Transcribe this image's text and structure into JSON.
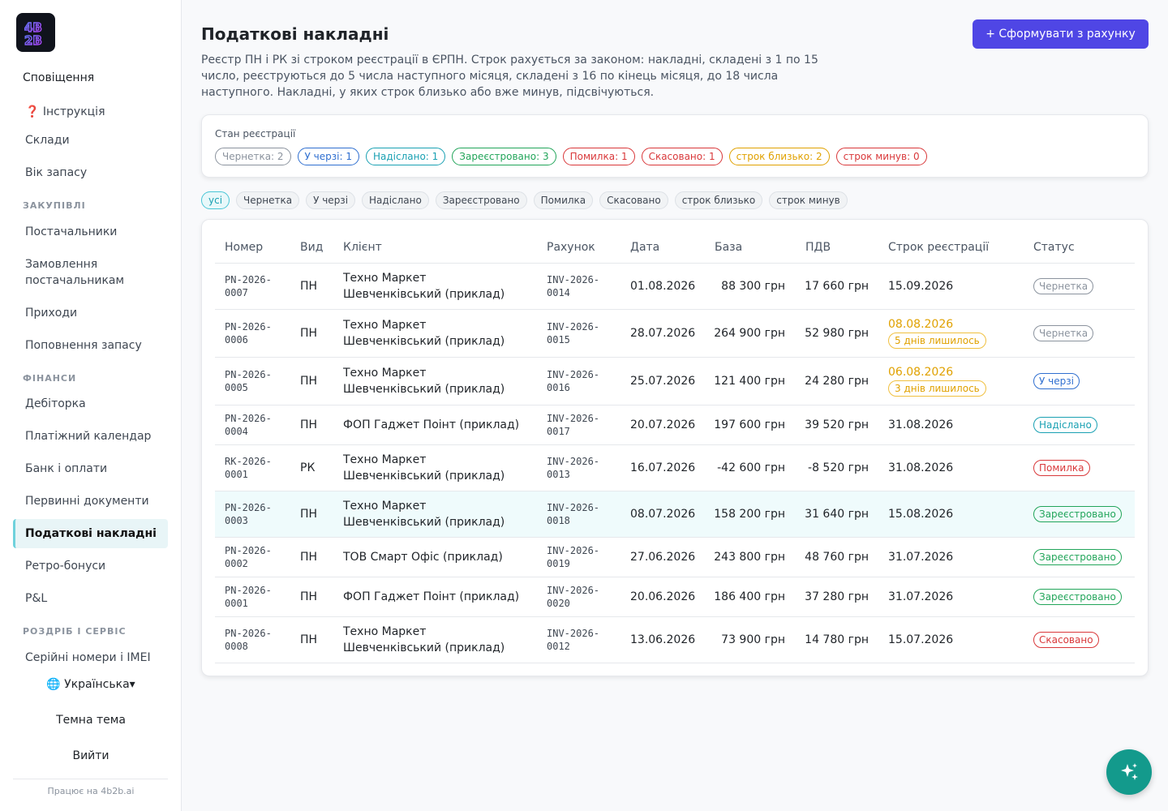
{
  "sidebar": {
    "notifications": "Сповіщення",
    "items_top": [
      {
        "label": "❓ Інструкція"
      },
      {
        "label": "Склади"
      },
      {
        "label": "Вік запасу"
      }
    ],
    "section_purchases": "ЗАКУПІВЛІ",
    "items_purchases": [
      {
        "label": "Постачальники"
      },
      {
        "label": "Замовлення постачальникам"
      },
      {
        "label": "Приходи"
      },
      {
        "label": "Поповнення запасу"
      }
    ],
    "section_finance": "ФІНАНСИ",
    "items_finance": [
      {
        "label": "Дебіторка"
      },
      {
        "label": "Платіжний календар"
      },
      {
        "label": "Банк і оплати"
      },
      {
        "label": "Первинні документи"
      },
      {
        "label": "Податкові накладні"
      },
      {
        "label": "Ретро-бонуси"
      },
      {
        "label": "P&L"
      }
    ],
    "section_retail": "РОЗДРІБ І СЕРВІС",
    "items_retail": [
      {
        "label": "Серійні номери і IMEI"
      }
    ],
    "language": "🌐 Українська▾",
    "theme": "Темна тема",
    "logout": "Вийти",
    "powered": "Працює на 4b2b.ai"
  },
  "header": {
    "title": "Податкові накладні",
    "description": "Реєстр ПН і РК зі строком реєстрації в ЄРПН. Строк рахується за законом: накладні, складені з 1 по 15 число, реєструються до 5 числа наступного місяця, складені з 16 по кінець місяця, до 18 числа наступного. Накладні, у яких строк близько або вже минув, підсвічуються.",
    "create_button": "+ Сформувати з рахунку"
  },
  "status_summary": {
    "label": "Стан реєстрації",
    "chips": [
      {
        "text": "Чернетка: 2",
        "color": "#8b939e"
      },
      {
        "text": "У черзі: 1",
        "color": "#2f6fd0"
      },
      {
        "text": "Надіслано: 1",
        "color": "#1aa1b3"
      },
      {
        "text": "Зареєстровано: 3",
        "color": "#22a55a"
      },
      {
        "text": "Помилка: 1",
        "color": "#d9383a"
      },
      {
        "text": "Скасовано: 1",
        "color": "#d9383a"
      },
      {
        "text": "строк близько: 2",
        "color": "#e0a100"
      },
      {
        "text": "строк минув: 0",
        "color": "#d9383a"
      }
    ]
  },
  "filters": [
    {
      "label": "усі"
    },
    {
      "label": "Чернетка"
    },
    {
      "label": "У черзі"
    },
    {
      "label": "Надіслано"
    },
    {
      "label": "Зареєстровано"
    },
    {
      "label": "Помилка"
    },
    {
      "label": "Скасовано"
    },
    {
      "label": "строк близько"
    },
    {
      "label": "строк минув"
    }
  ],
  "table": {
    "columns": [
      "Номер",
      "Вид",
      "Клієнт",
      "Рахунок",
      "Дата",
      "База",
      "ПДВ",
      "Строк реєстрації",
      "Статус"
    ],
    "rows": [
      {
        "number": "PN-2026-\n0007",
        "type": "ПН",
        "client": "Техно Маркет\nШевченківський (приклад)",
        "invoice": "INV-2026-\n0014",
        "date": "01.08.2026",
        "base": "88 300 грн",
        "vat": "17 660 грн",
        "deadline": "15.09.2026",
        "deadline_note": "",
        "status": "Чернетка",
        "status_color": "#8b939e"
      },
      {
        "number": "PN-2026-\n0006",
        "type": "ПН",
        "client": "Техно Маркет\nШевченківський (приклад)",
        "invoice": "INV-2026-\n0015",
        "date": "28.07.2026",
        "base": "264 900 грн",
        "vat": "52 980 грн",
        "deadline": "08.08.2026",
        "deadline_note": "5 днів лишилось",
        "status": "Чернетка",
        "status_color": "#8b939e"
      },
      {
        "number": "PN-2026-\n0005",
        "type": "ПН",
        "client": "Техно Маркет\nШевченківський (приклад)",
        "invoice": "INV-2026-\n0016",
        "date": "25.07.2026",
        "base": "121 400 грн",
        "vat": "24 280 грн",
        "deadline": "06.08.2026",
        "deadline_note": "3 днів лишилось",
        "status": "У черзі",
        "status_color": "#2f6fd0"
      },
      {
        "number": "PN-2026-\n0004",
        "type": "ПН",
        "client": "ФОП Гаджет Поінт (приклад)",
        "invoice": "INV-2026-\n0017",
        "date": "20.07.2026",
        "base": "197 600 грн",
        "vat": "39 520 грн",
        "deadline": "31.08.2026",
        "deadline_note": "",
        "status": "Надіслано",
        "status_color": "#1aa1b3"
      },
      {
        "number": "RK-2026-\n0001",
        "type": "РК",
        "client": "Техно Маркет\nШевченківський (приклад)",
        "invoice": "INV-2026-\n0013",
        "date": "16.07.2026",
        "base": "-42 600 грн",
        "vat": "-8 520 грн",
        "deadline": "31.08.2026",
        "deadline_note": "",
        "status": "Помилка",
        "status_color": "#d9383a"
      },
      {
        "number": "PN-2026-\n0003",
        "type": "ПН",
        "client": "Техно Маркет\nШевченківський (приклад)",
        "invoice": "INV-2026-\n0018",
        "date": "08.07.2026",
        "base": "158 200 грн",
        "vat": "31 640 грн",
        "deadline": "15.08.2026",
        "deadline_note": "",
        "status": "Зареєстровано",
        "status_color": "#22a55a"
      },
      {
        "number": "PN-2026-\n0002",
        "type": "ПН",
        "client": "ТОВ Смарт Офіс (приклад)",
        "invoice": "INV-2026-\n0019",
        "date": "27.06.2026",
        "base": "243 800 грн",
        "vat": "48 760 грн",
        "deadline": "31.07.2026",
        "deadline_note": "",
        "status": "Зареєстровано",
        "status_color": "#22a55a"
      },
      {
        "number": "PN-2026-\n0001",
        "type": "ПН",
        "client": "ФОП Гаджет Поінт (приклад)",
        "invoice": "INV-2026-\n0020",
        "date": "20.06.2026",
        "base": "186 400 грн",
        "vat": "37 280 грн",
        "deadline": "31.07.2026",
        "deadline_note": "",
        "status": "Зареєстровано",
        "status_color": "#22a55a"
      },
      {
        "number": "PN-2026-\n0008",
        "type": "ПН",
        "client": "Техно Маркет\nШевченківський (приклад)",
        "invoice": "INV-2026-\n0012",
        "date": "13.06.2026",
        "base": "73 900 грн",
        "vat": "14 780 грн",
        "deadline": "15.07.2026",
        "deadline_note": "",
        "status": "Скасовано",
        "status_color": "#d9383a"
      }
    ]
  },
  "fab_icon": "sparkles-icon"
}
